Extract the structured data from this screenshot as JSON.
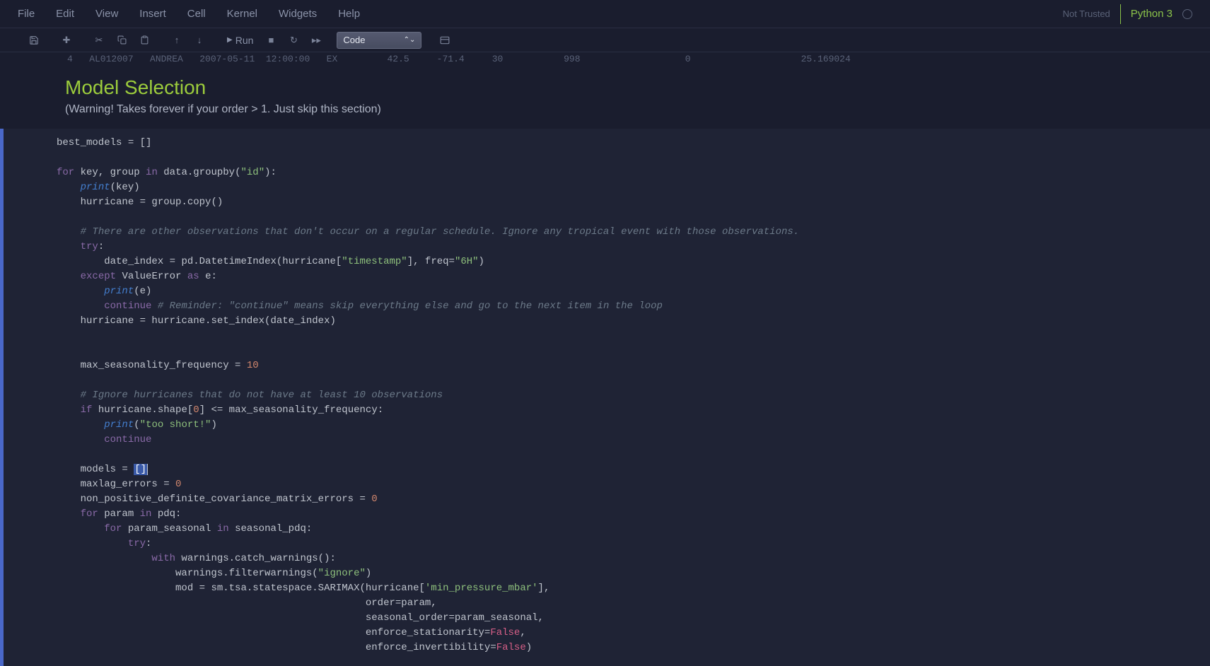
{
  "menubar": {
    "items": [
      "File",
      "Edit",
      "View",
      "Insert",
      "Cell",
      "Kernel",
      "Widgets",
      "Help"
    ]
  },
  "header": {
    "not_trusted": "Not Trusted",
    "kernel": "Python 3"
  },
  "toolbar": {
    "run_label": "Run",
    "cell_type": "Code"
  },
  "data_fragment": "4   AL012007   ANDREA   2007-05-11  12:00:00   EX         42.5     -71.4     30           998                   0                    25.169024",
  "markdown": {
    "heading": "Model Selection",
    "paragraph": "(Warning! Takes forever if your order > 1. Just skip this section)"
  },
  "code": {
    "lines": [
      {
        "t": "plain",
        "s": "best_models = []"
      },
      {
        "t": "blank"
      },
      {
        "t": "for_line"
      },
      {
        "t": "print_key"
      },
      {
        "t": "hurricane_copy"
      },
      {
        "t": "blank"
      },
      {
        "t": "comment1"
      },
      {
        "t": "try"
      },
      {
        "t": "date_index"
      },
      {
        "t": "except"
      },
      {
        "t": "print_e"
      },
      {
        "t": "continue1"
      },
      {
        "t": "hurricane_set"
      },
      {
        "t": "blank"
      },
      {
        "t": "blank"
      },
      {
        "t": "max_seas"
      },
      {
        "t": "blank"
      },
      {
        "t": "comment2"
      },
      {
        "t": "if_shape"
      },
      {
        "t": "print_short"
      },
      {
        "t": "continue2"
      },
      {
        "t": "blank"
      },
      {
        "t": "models_eq"
      },
      {
        "t": "maxlag"
      },
      {
        "t": "nonpos"
      },
      {
        "t": "for_pdq"
      },
      {
        "t": "for_seasonal"
      },
      {
        "t": "try2"
      },
      {
        "t": "with_warn"
      },
      {
        "t": "filter_warn"
      },
      {
        "t": "mod_sarimax"
      },
      {
        "t": "order"
      },
      {
        "t": "seasonal_order"
      },
      {
        "t": "enforce_stat"
      },
      {
        "t": "enforce_inv"
      }
    ],
    "strings": {
      "id": "\"id\"",
      "timestamp": "\"timestamp\"",
      "sixH": "\"6H\"",
      "too_short": "\"too short!\"",
      "ignore": "\"ignore\"",
      "min_pressure": "'min_pressure_mbar'"
    },
    "comments": {
      "c1": "# There are other observations that don't occur on a regular schedule. Ignore any tropical event with those observations.",
      "c2": "# Reminder: \"continue\" means skip everything else and go to the next item in the loop",
      "c3": "# Ignore hurricanes that do not have at least 10 observations"
    },
    "numbers": {
      "ten": "10",
      "zero": "0",
      "zero2": "0",
      "zero3": "0"
    }
  }
}
